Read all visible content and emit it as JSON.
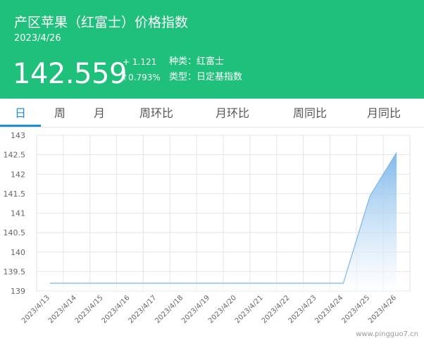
{
  "header": {
    "title": "产区苹果（红富士）价格指数",
    "date": "2023/4/26",
    "price": "142.559",
    "change": "+ 1.121",
    "change_pct": "↑0.793%",
    "variety_label": "种类：红富士",
    "type_label": "类型：日定基指数"
  },
  "tabs": [
    {
      "label": "日",
      "active": true
    },
    {
      "label": "周",
      "active": false
    },
    {
      "label": "月",
      "active": false
    },
    {
      "label": "周环比",
      "active": false
    },
    {
      "label": "月环比",
      "active": false
    },
    {
      "label": "周同比",
      "active": false
    },
    {
      "label": "月同比",
      "active": false
    }
  ],
  "chart_data": {
    "type": "area",
    "x": [
      "2023/4/13",
      "2023/4/14",
      "2023/4/15",
      "2023/4/16",
      "2023/4/17",
      "2023/4/18",
      "2023/4/19",
      "2023/4/20",
      "2023/4/21",
      "2023/4/22",
      "2023/4/23",
      "2023/4/24",
      "2023/4/25",
      "2023/4/26"
    ],
    "values": [
      139.2,
      139.2,
      139.2,
      139.2,
      139.2,
      139.2,
      139.2,
      139.2,
      139.2,
      139.2,
      139.2,
      139.2,
      141.44,
      142.559
    ],
    "ylim": [
      139,
      143
    ],
    "yticks": [
      "139",
      "139.5",
      "140",
      "140.5",
      "141",
      "141.5",
      "142",
      "142.5",
      "143"
    ],
    "grid": true,
    "line_color": "#7ab6ea",
    "fill_color_top": "#7ab6ea",
    "fill_color_bottom": "#ffffff"
  },
  "watermark": "www.pingguo7.cn",
  "colors": {
    "header_bg": "#1fbf7c",
    "accent": "#1a8fe0"
  }
}
